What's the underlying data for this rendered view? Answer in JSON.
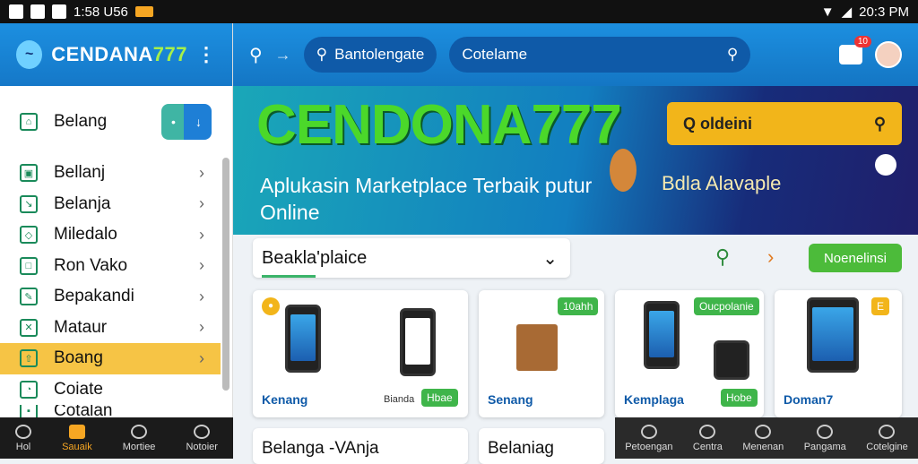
{
  "status": {
    "left": "1:58 U56",
    "time": "20:3 PM"
  },
  "brand": {
    "name_a": "CENDANA",
    "name_b": "777"
  },
  "menu": [
    {
      "label": "Belang",
      "icon": "store-icon"
    },
    {
      "label": "Bellanj",
      "icon": "image-icon"
    },
    {
      "label": "Belanja",
      "icon": "cursor-icon"
    },
    {
      "label": "Miledalo",
      "icon": "box-icon"
    },
    {
      "label": "Ron Vako",
      "icon": "doc-icon"
    },
    {
      "label": "Bepakandi",
      "icon": "pencil-icon"
    },
    {
      "label": "Mataur",
      "icon": "chart-icon"
    },
    {
      "label": "Boang",
      "icon": "share-icon"
    },
    {
      "label": "Coiate",
      "icon": "clock-icon"
    },
    {
      "label": "Cotalan",
      "icon": "lock-icon"
    }
  ],
  "bottomnav_left": [
    "Hol",
    "Sauaik",
    "Mortiee",
    "Notoier"
  ],
  "topbar": {
    "search1": "Bantolengate",
    "search2": "Cotelame",
    "badge": "10"
  },
  "banner": {
    "title": "CENDONA777",
    "subtitle": "Aplukasin Marketplace Terbaik putur Online",
    "search": "Q oldeini",
    "tag": "Bdla Alavaple"
  },
  "filter": {
    "label": "Beakla'plaice",
    "button": "Noenelinsi"
  },
  "cards": [
    {
      "tag": "Kenang",
      "sub": "Bianda",
      "badge": "Hbae"
    },
    {
      "tag": "Senang",
      "badge": "10ahh"
    },
    {
      "tag": "Kemplaga",
      "badge": "Hobe",
      "top": "Oucpolanie"
    },
    {
      "tag": "Doman7",
      "top": "E"
    }
  ],
  "bottomcards": [
    "Belanga -VAnja",
    "Belaniag"
  ],
  "bottomnav_right": [
    "Petoengan",
    "Centra",
    "Menenan",
    "Pangama",
    "Cotelgine"
  ]
}
